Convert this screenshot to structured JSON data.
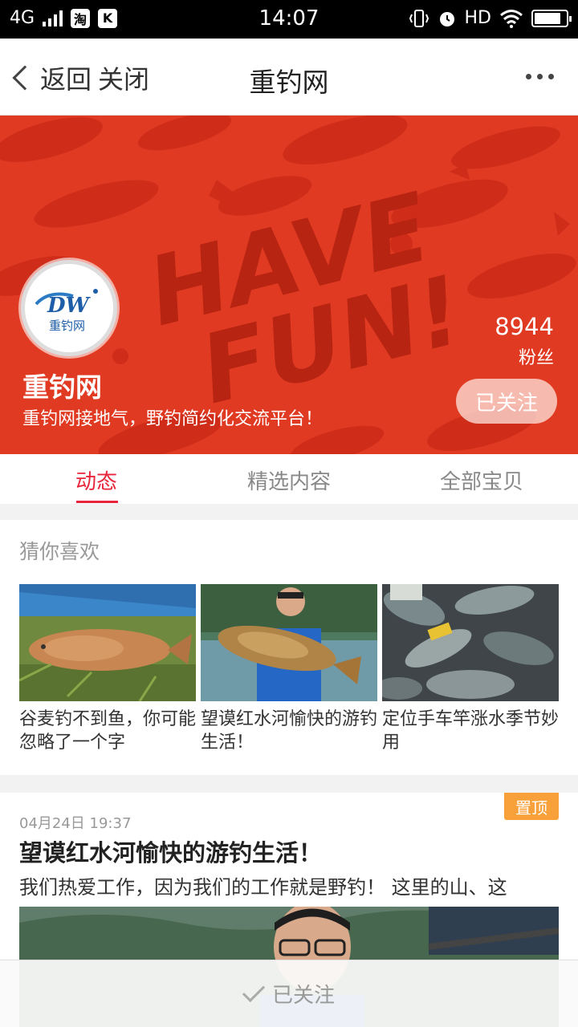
{
  "status_bar": {
    "network": "4G",
    "app_icon_1": "淘",
    "app_icon_2": "K",
    "time": "14:07",
    "hd": "HD"
  },
  "nav": {
    "back_label": "返回",
    "close_label": "关闭",
    "title": "重钓网"
  },
  "shop": {
    "name": "重钓网",
    "description": "重钓网接地气，野钓简约化交流平台！",
    "fans_count": "8944",
    "fans_label": "粉丝",
    "follow_label": "已关注",
    "logo_text": "DW",
    "logo_sub": "重钓网"
  },
  "tabs": [
    {
      "label": "动态",
      "active": true
    },
    {
      "label": "精选内容",
      "active": false
    },
    {
      "label": "全部宝贝",
      "active": false
    }
  ],
  "recommend": {
    "title": "猜你喜欢",
    "items": [
      {
        "caption": "谷麦钓不到鱼，你可能忽略了一个字"
      },
      {
        "caption": "望谟红水河愉快的游钓生活！"
      },
      {
        "caption": "定位手车竿涨水季节妙用"
      }
    ]
  },
  "post": {
    "pin_label": "置顶",
    "date": "04月24日 19:37",
    "title": "望谟红水河愉快的游钓生活！",
    "excerpt": "我们热爱工作，因为我们的工作就是野钓！ 这里的山、这"
  },
  "bottom_bar": {
    "follow_label": "已关注"
  },
  "colors": {
    "accent": "#e8253b",
    "banner": "#e13a22",
    "pin": "#f8a13a"
  },
  "icons": [
    "signal-icon",
    "back-chevron-icon",
    "more-icon",
    "vibrate-icon",
    "alarm-icon",
    "wifi-icon",
    "battery-icon",
    "check-icon"
  ]
}
